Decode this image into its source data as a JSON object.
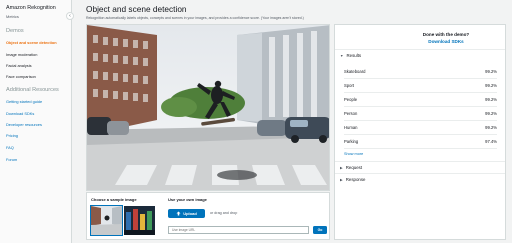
{
  "sidebar": {
    "title": "Amazon Rekognition",
    "collapse_icon": "chevron-left-icon",
    "metrics": "Metrics",
    "demos_heading": "Demos",
    "demos": [
      {
        "label": "Object and scene detection",
        "active": true
      },
      {
        "label": "Image moderation"
      },
      {
        "label": "Facial analysis"
      },
      {
        "label": "Face comparison"
      }
    ],
    "resources_heading": "Additional Resources",
    "resources": [
      {
        "label": "Getting started guide"
      },
      {
        "label": "Download SDKs"
      },
      {
        "label": "Developer resources"
      },
      {
        "label": "Pricing"
      },
      {
        "label": "FAQ"
      },
      {
        "label": "Forum"
      }
    ]
  },
  "main": {
    "title": "Object and scene detection",
    "description": "Rekognition automatically labels objects, concepts and scenes in your images, and provides a confidence score. (Your images aren't stored.)"
  },
  "sample": {
    "heading": "Choose a sample image",
    "upload_heading": "Use your own image",
    "upload_label": "Upload",
    "upload_icon": "upload-icon",
    "drag_text": "or drag and drop",
    "url_placeholder": "Use image URL",
    "go_label": "Go"
  },
  "panel": {
    "done_text": "Done with the demo?",
    "sdk_link": "Download SDKs",
    "results_heading": "Results",
    "results": [
      {
        "label": "Skateboard",
        "value": "99.2%"
      },
      {
        "label": "Sport",
        "value": "99.2%"
      },
      {
        "label": "People",
        "value": "99.2%"
      },
      {
        "label": "Person",
        "value": "99.2%"
      },
      {
        "label": "Human",
        "value": "99.2%"
      },
      {
        "label": "Parking",
        "value": "97.4%"
      }
    ],
    "show_more": "Show more",
    "request_heading": "Request",
    "response_heading": "Response"
  },
  "colors": {
    "accent": "#0073bb",
    "active_nav": "#ec7211"
  }
}
